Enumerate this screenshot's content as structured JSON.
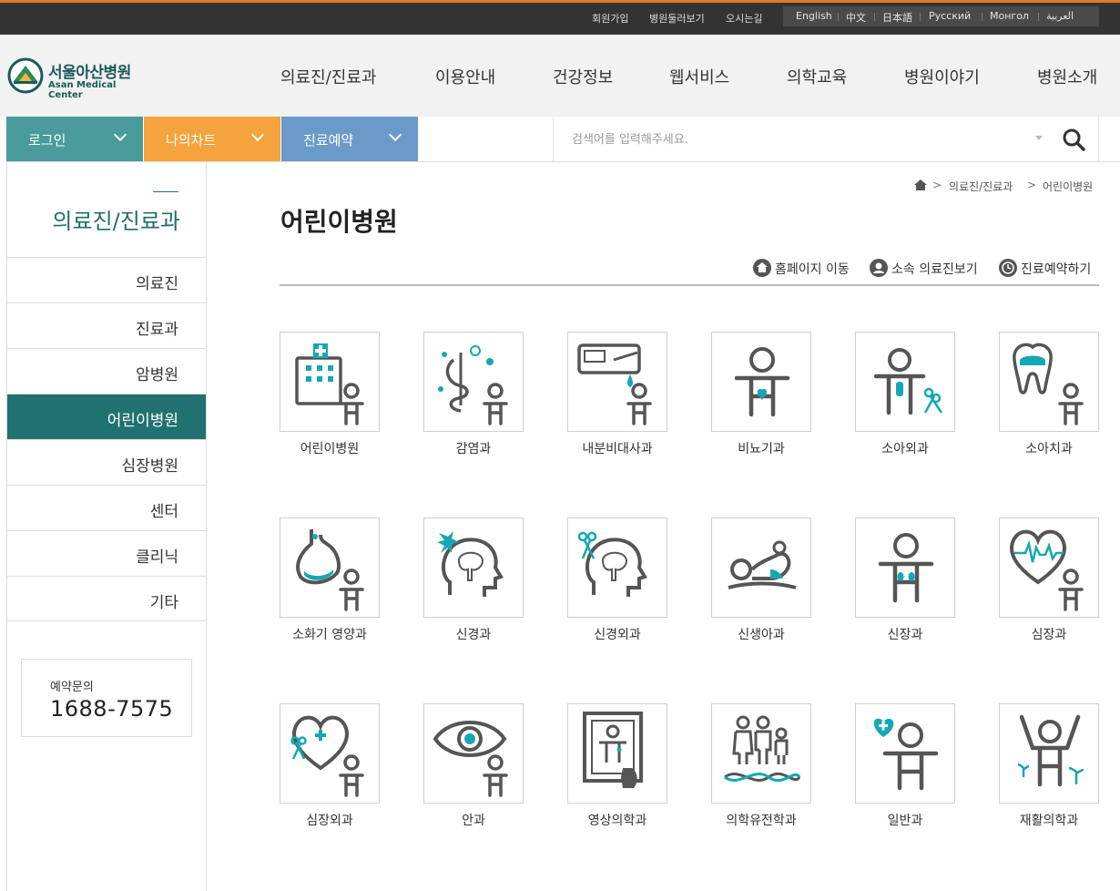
{
  "topbar": {
    "links": [
      "회원가입",
      "병원둘러보기",
      "오시는길"
    ],
    "languages": [
      "English",
      "中文",
      "日本語",
      "Русский",
      "Монгол",
      "العربية"
    ]
  },
  "logo": {
    "name_kr": "서울아산병원",
    "name_en": "Asan Medical Center"
  },
  "gnb": [
    "의료진/진료과",
    "이용안내",
    "건강정보",
    "웹서비스",
    "의학교육",
    "병원이야기",
    "병원소개"
  ],
  "quickbar": {
    "login": "로그인",
    "mychart": "나의차트",
    "reserve": "진료예약",
    "colors": {
      "login": "#4a9b9b",
      "mychart": "#f5a33c",
      "reserve": "#6a9bc8"
    }
  },
  "search": {
    "placeholder": "검색어를 입력해주세요.",
    "icon": "magnifier-icon"
  },
  "sidebar": {
    "title": "의료진/진료과",
    "items": [
      "의료진",
      "진료과",
      "암병원",
      "어린이병원",
      "심장병원",
      "센터",
      "클리닉",
      "기타"
    ],
    "active_index": 3,
    "contact_label": "예약문의",
    "contact_number": "1688-7575"
  },
  "breadcrumb": {
    "home_icon": "home-icon",
    "items": [
      "의료진/진료과",
      "어린이병원"
    ]
  },
  "page_title": "어린이병원",
  "actions": [
    "홈페이지 이동",
    "소속 의료진보기",
    "진료예약하기"
  ],
  "departments": [
    "어린이병원",
    "감염과",
    "내분비대사과",
    "비뇨기과",
    "소아외과",
    "소아치과",
    "소화기 영양과",
    "신경과",
    "신경외과",
    "신생아과",
    "신장과",
    "심장과",
    "심장외과",
    "안과",
    "영상의학과",
    "의학유전학과",
    "일반과",
    "재활의학과"
  ],
  "colors": {
    "accent": "#1f7270",
    "icon_teal": "#14a8b4",
    "icon_gray": "#555555"
  }
}
